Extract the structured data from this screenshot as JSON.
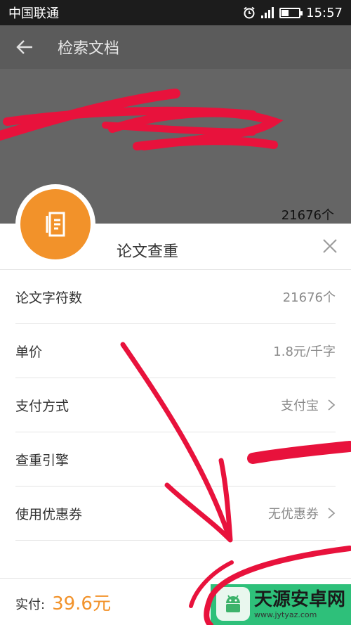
{
  "status_bar": {
    "carrier": "中国联通",
    "time": "15:57",
    "battery_level": 0.4
  },
  "header": {
    "title": "检索文档"
  },
  "background": {
    "char_count": "21676个"
  },
  "sheet": {
    "title": "论文查重",
    "rows": [
      {
        "label": "论文字符数",
        "value": "21676个"
      },
      {
        "label": "单价",
        "value": "1.8元/千字"
      },
      {
        "label": "支付方式",
        "value": "支付宝"
      },
      {
        "label": "查重引擎",
        "value": ""
      },
      {
        "label": "使用优惠券",
        "value": "无优惠券"
      }
    ]
  },
  "footer": {
    "total_label": "实付:",
    "total_value": "39.6元"
  },
  "watermark": {
    "name": "天源安卓网",
    "url": "www.jytyaz.com"
  },
  "colors": {
    "accent_orange": "#f2922a",
    "pay_green": "#2ec07a",
    "annotation_red": "#e8123c"
  }
}
